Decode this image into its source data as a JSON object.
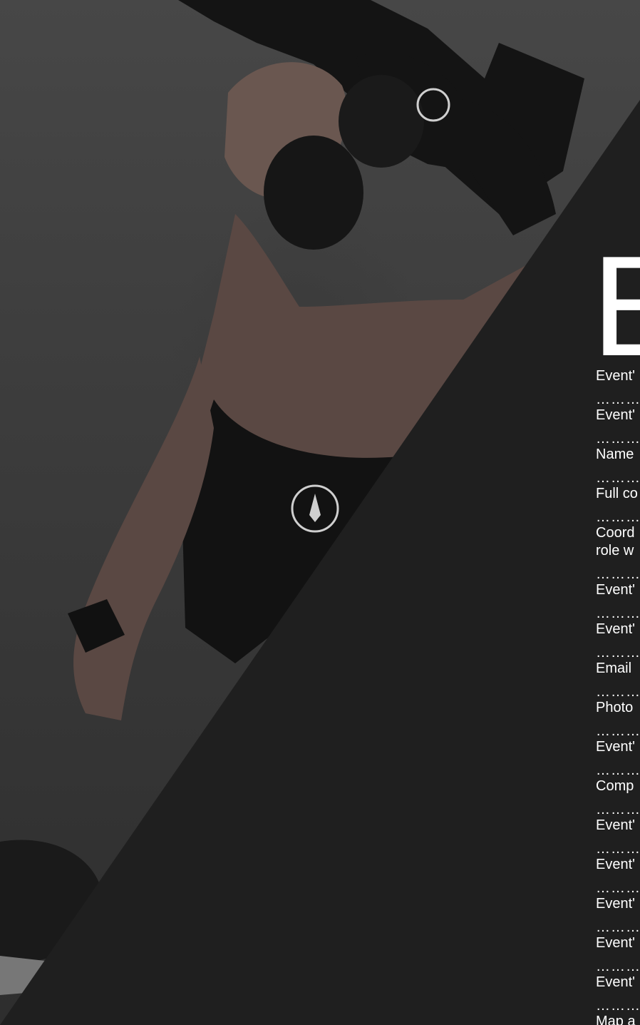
{
  "form": {
    "heading_letter": "E",
    "fields": [
      {
        "label": "Event'"
      },
      {
        "label": "Event'"
      },
      {
        "label": "Name"
      },
      {
        "label": "Full co"
      },
      {
        "label": "Coord",
        "label_line2": "role w"
      },
      {
        "label": "Event'"
      },
      {
        "label": "Event'"
      },
      {
        "label": "Email"
      },
      {
        "label": "Photo"
      },
      {
        "label": "Event'"
      },
      {
        "label": "Comp"
      },
      {
        "label": "Event'"
      },
      {
        "label": "Event'"
      },
      {
        "label": "Event'"
      },
      {
        "label": "Event'"
      },
      {
        "label": "Event'"
      },
      {
        "label": "Map a"
      }
    ],
    "dots": "……………………"
  },
  "colors": {
    "panel": "#1f1f1f",
    "text": "#ffffff",
    "photo_bg": "#3f3f3f"
  }
}
